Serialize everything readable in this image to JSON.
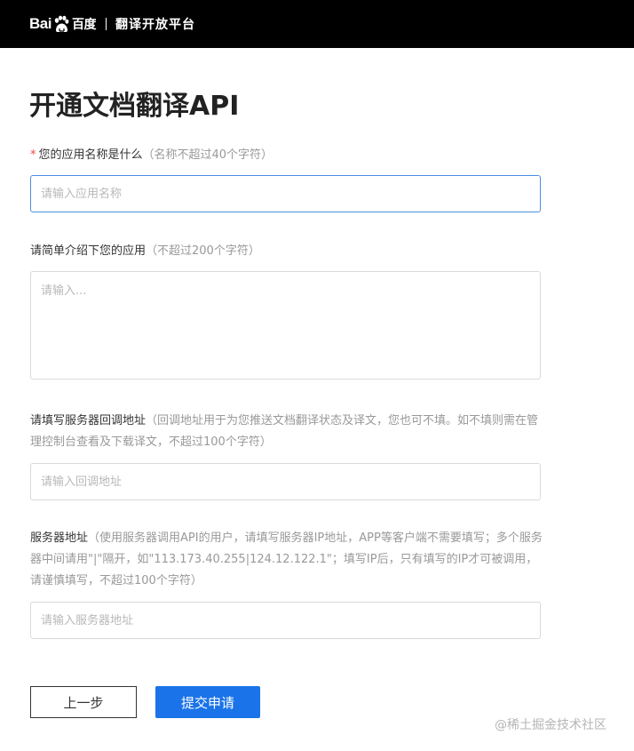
{
  "header": {
    "logo_latin_1": "Bai",
    "logo_latin_2": "du",
    "logo_cn": "百度",
    "product": "翻译开放平台"
  },
  "page": {
    "title": "开通文档翻译API"
  },
  "form": {
    "app_name": {
      "required_mark": "*",
      "label": "您的应用名称是什么",
      "hint": "（名称不超过40个字符）",
      "placeholder": "请输入应用名称",
      "value": ""
    },
    "app_intro": {
      "label": "请简单介绍下您的应用",
      "hint": "（不超过200个字符）",
      "placeholder": "请输入...",
      "value": ""
    },
    "callback": {
      "label": "请填写服务器回调地址",
      "hint": "（回调地址用于为您推送文档翻译状态及译文，您也可不填。如不填则需在管理控制台查看及下载译文，不超过100个字符）",
      "placeholder": "请输入回调地址",
      "value": ""
    },
    "server": {
      "label": "服务器地址",
      "hint": "（使用服务器调用API的用户，请填写服务器IP地址，APP等客户端不需要填写；多个服务器中间请用\"|\"隔开，如\"113.173.40.255|124.12.122.1\"；填写IP后，只有填写的IP才可被调用，请谨慎填写，不超过100个字符）",
      "placeholder": "请输入服务器地址",
      "value": ""
    }
  },
  "buttons": {
    "prev": "上一步",
    "submit": "提交申请"
  },
  "watermark": "@稀土掘金技术社区",
  "colors": {
    "header_bg": "#000000",
    "accent": "#1a73e8",
    "focus_border": "#4a90e2",
    "required": "#e84a3c"
  }
}
